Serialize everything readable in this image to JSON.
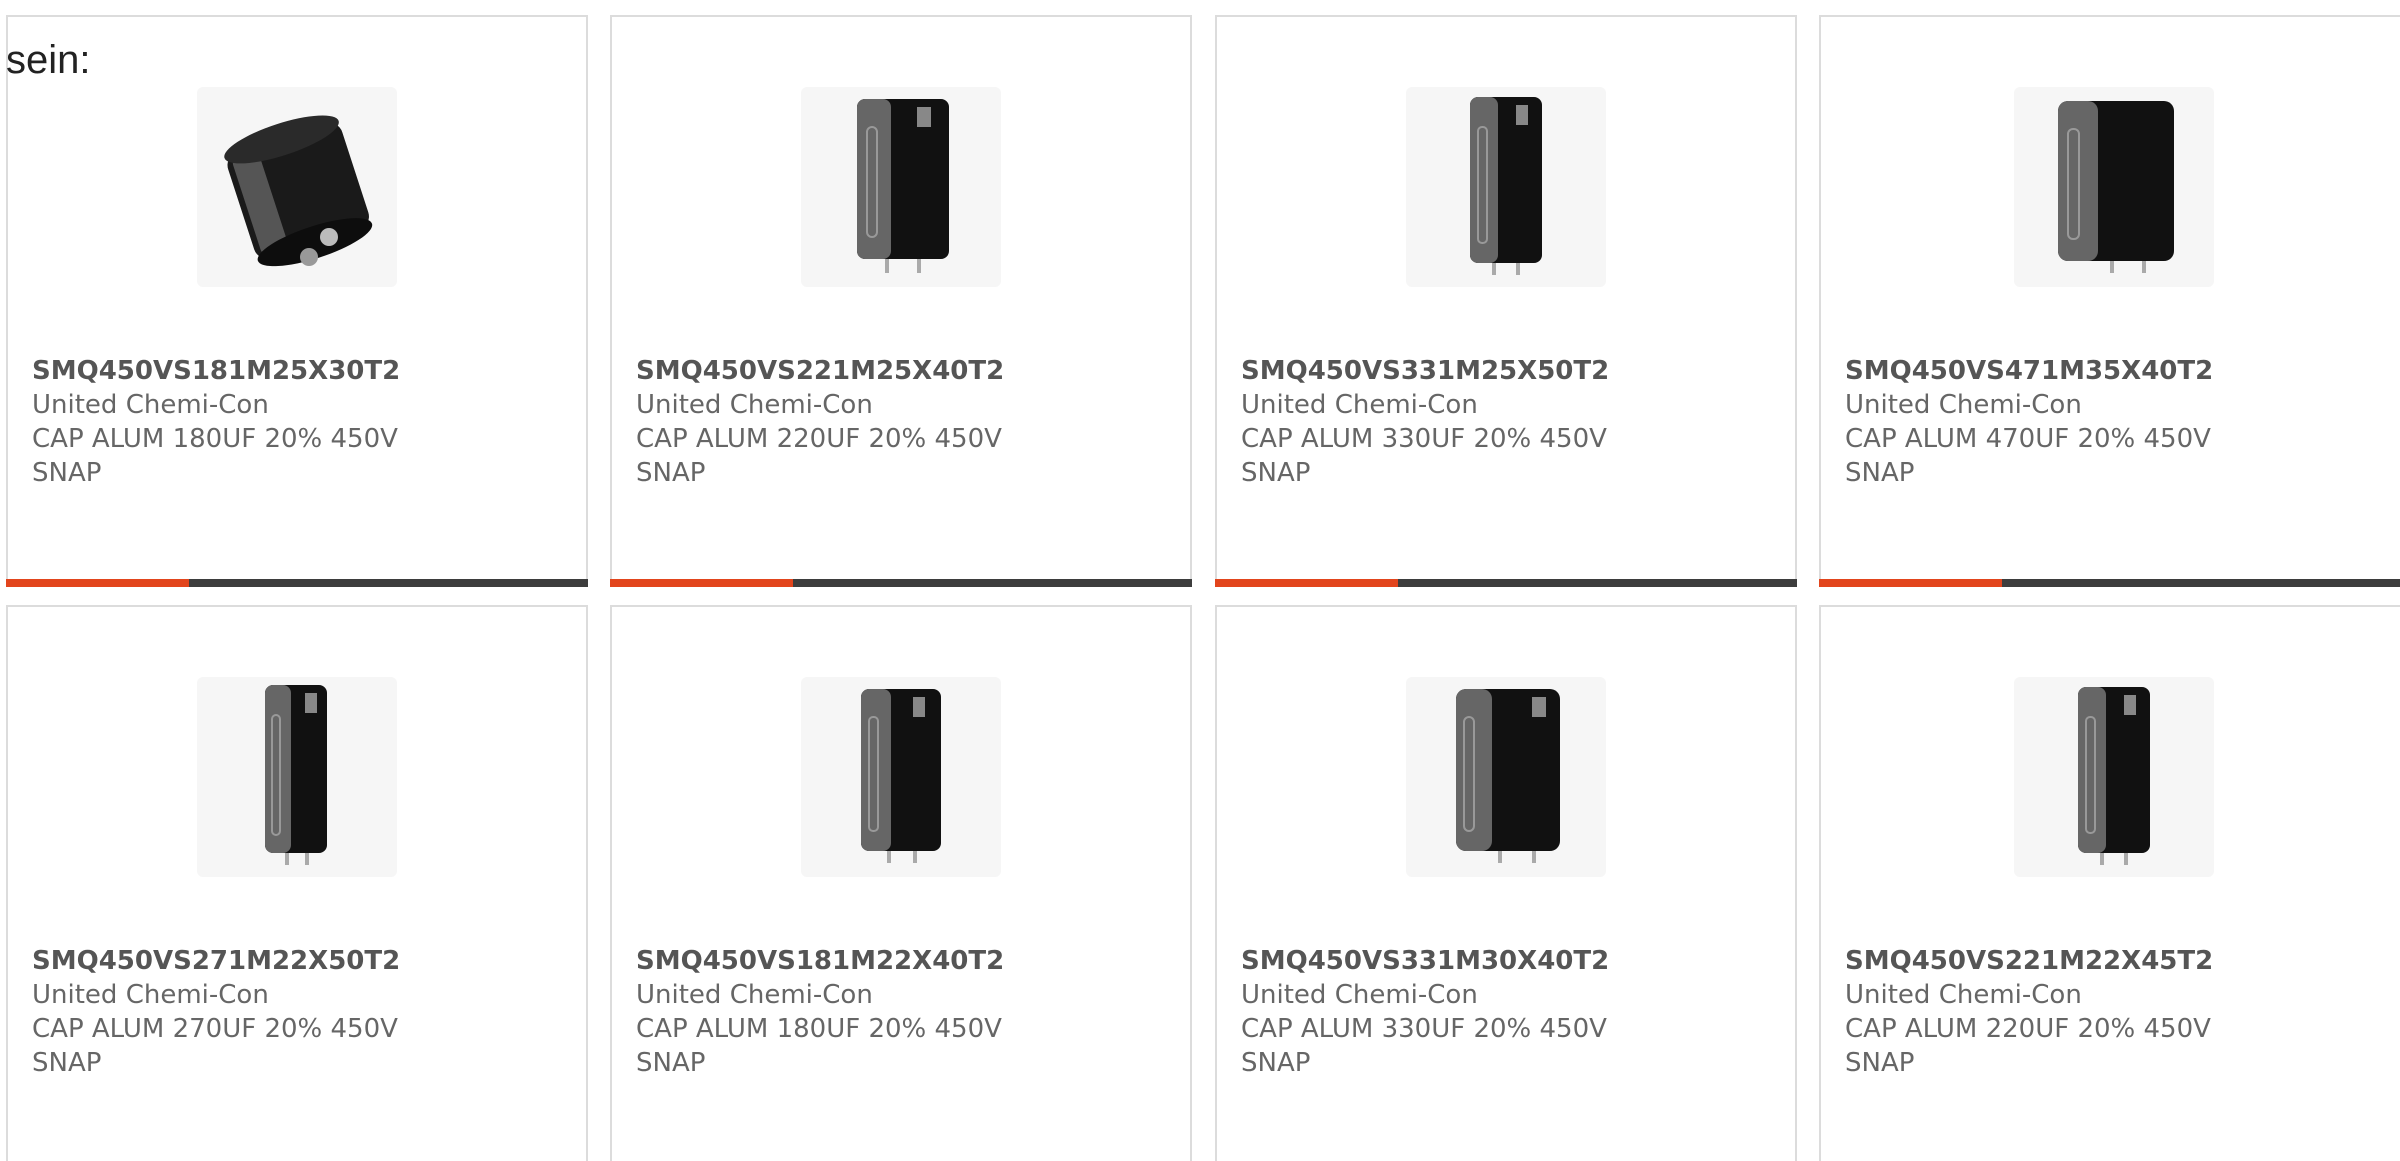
{
  "intro_text": "sein:",
  "accent_color": "#e2451d",
  "track_color": "#3d3d3d",
  "products": [
    {
      "part": "SMQ450VS181M25X30T2",
      "maker": "United Chemi-Con",
      "desc": "CAP ALUM 180UF 20% 450V",
      "package": "SNAP",
      "image": "capacitor-snap-in-tilted"
    },
    {
      "part": "SMQ450VS221M25X40T2",
      "maker": "United Chemi-Con",
      "desc": "CAP ALUM 220UF 20% 450V",
      "package": "SNAP",
      "image": "capacitor-snap-in-upright"
    },
    {
      "part": "SMQ450VS331M25X50T2",
      "maker": "United Chemi-Con",
      "desc": "CAP ALUM 330UF 20% 450V",
      "package": "SNAP",
      "image": "capacitor-snap-in-upright"
    },
    {
      "part": "SMQ450VS471M35X40T2",
      "maker": "United Chemi-Con",
      "desc": "CAP ALUM 470UF 20% 450V",
      "package": "SNAP",
      "image": "capacitor-snap-in-upright"
    },
    {
      "part": "SMQ450VS271M22X50T2",
      "maker": "United Chemi-Con",
      "desc": "CAP ALUM 270UF 20% 450V",
      "package": "SNAP",
      "image": "capacitor-snap-in-upright"
    },
    {
      "part": "SMQ450VS181M22X40T2",
      "maker": "United Chemi-Con",
      "desc": "CAP ALUM 180UF 20% 450V",
      "package": "SNAP",
      "image": "capacitor-snap-in-upright"
    },
    {
      "part": "SMQ450VS331M30X40T2",
      "maker": "United Chemi-Con",
      "desc": "CAP ALUM 330UF 20% 450V",
      "package": "SNAP",
      "image": "capacitor-snap-in-upright"
    },
    {
      "part": "SMQ450VS221M22X45T2",
      "maker": "United Chemi-Con",
      "desc": "CAP ALUM 220UF 20% 450V",
      "package": "SNAP",
      "image": "capacitor-snap-in-upright"
    }
  ]
}
